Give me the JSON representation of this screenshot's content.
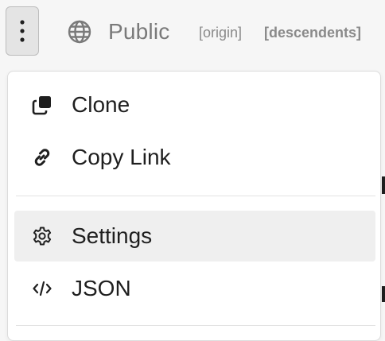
{
  "toolbar": {
    "more_button_icon": "vertical-ellipsis-icon",
    "visibility_icon": "globe-icon",
    "visibility_label": "Public",
    "tag_origin": "[origin]",
    "tag_descendents": "[descendents]"
  },
  "menu": {
    "items": [
      {
        "label": "Clone",
        "icon": "clone-icon"
      },
      {
        "label": "Copy Link",
        "icon": "link-icon"
      },
      {
        "label": "Settings",
        "icon": "gear-icon"
      },
      {
        "label": "JSON",
        "icon": "code-icon"
      }
    ]
  },
  "colors": {
    "menu_background": "#ffffff",
    "hover_background": "#efefef",
    "text": "#1f1f1f",
    "muted_text": "#7a7a7a"
  }
}
